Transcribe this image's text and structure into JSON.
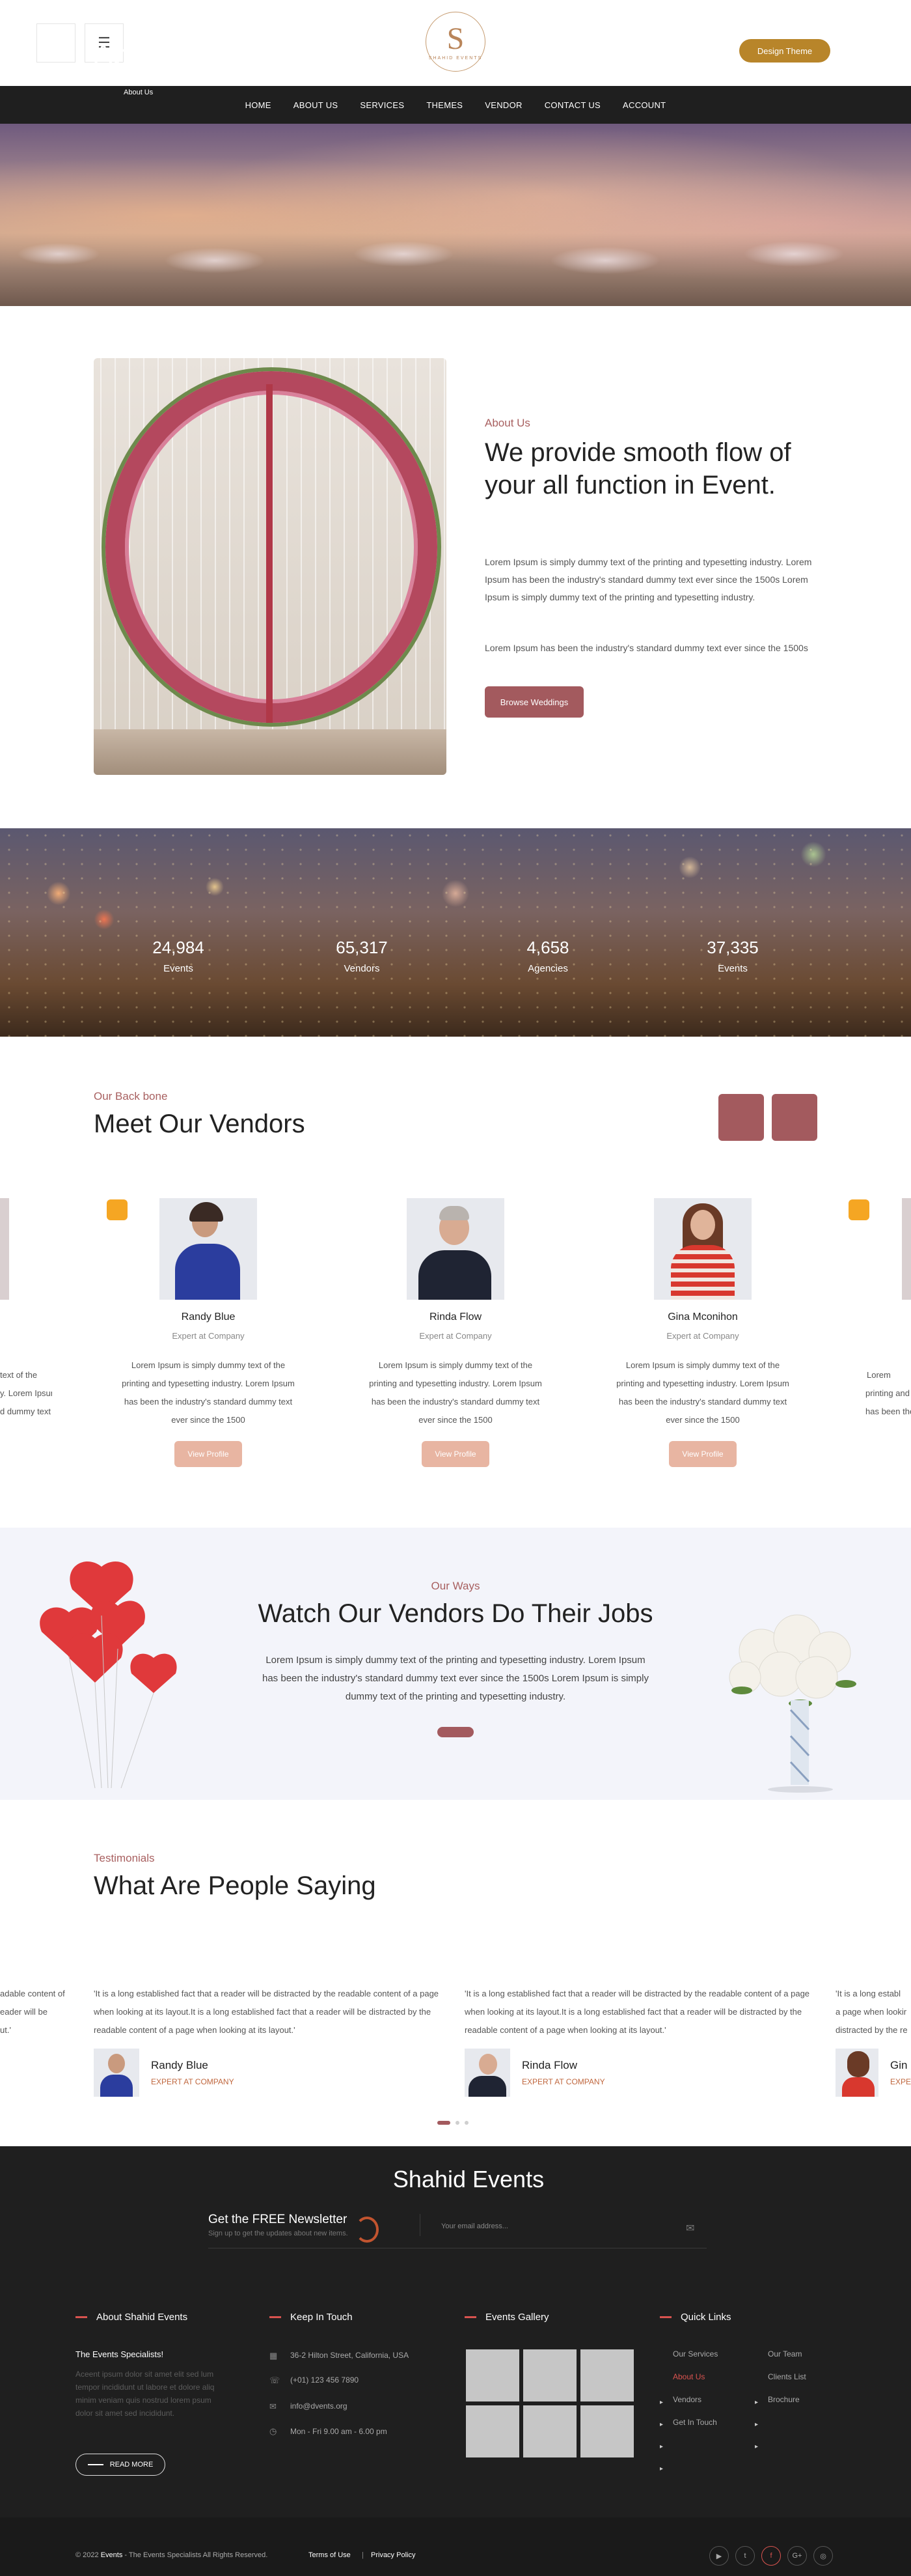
{
  "header": {
    "logo_letter": "S",
    "logo_text": "SHAHID EVENTS",
    "menu_icon": "hamburger-icon",
    "design_button": "Design Theme",
    "brand_color": "#b8852a"
  },
  "nav": [
    "HOME",
    "ABOUT US",
    "SERVICES",
    "THEMES",
    "VENDOR",
    "CONTACT US",
    "ACCOUNT"
  ],
  "hero": {
    "title": "About Us",
    "breadcrumb": "About Us"
  },
  "about": {
    "label": "About Us",
    "heading": "We provide smooth flow of your all function in Event.",
    "p1": "Lorem Ipsum is simply dummy text of the printing and typesetting industry. Lorem Ipsum has been the industry's standard dummy text ever since the 1500s Lorem Ipsum is simply dummy text of the printing and typesetting industry.",
    "p2": "Lorem Ipsum has been the industry's standard dummy text ever since the 1500s",
    "button": "Browse Weddings"
  },
  "counters": [
    {
      "value": "24,984",
      "label": "Events"
    },
    {
      "value": "65,317",
      "label": "Vendors"
    },
    {
      "value": "4,658",
      "label": "Agencies"
    },
    {
      "value": "37,335",
      "label": "Events"
    }
  ],
  "vendors": {
    "label": "Our Back bone",
    "heading": "Meet Our Vendors",
    "cards": [
      {
        "name": "Randy Blue",
        "role": "Expert at Company",
        "desc": "Lorem Ipsum is simply dummy text of the printing and typesetting industry. Lorem Ipsum has been the industry's standard dummy text ever since the 1500",
        "button": "View Profile"
      },
      {
        "name": "Rinda Flow",
        "role": "Expert at Company",
        "desc": "Lorem Ipsum is simply dummy text of the printing and typesetting industry. Lorem Ipsum has been the industry's standard dummy text ever since the 1500",
        "button": "View Profile"
      },
      {
        "name": "Gina Mconihon",
        "role": "Expert at Company",
        "desc": "Lorem Ipsum is simply dummy text of the printing and typesetting industry. Lorem Ipsum has been the industry's standard dummy text ever since the 1500",
        "button": "View Profile"
      }
    ],
    "left_partial": [
      "text of the",
      "y. Lorem Ipsum",
      "d dummy text"
    ],
    "right_partial": [
      "Lorem",
      "printing and",
      "has been the"
    ]
  },
  "ways": {
    "label": "Our Ways",
    "heading": "Watch Our Vendors Do Their Jobs",
    "text": "Lorem Ipsum is simply dummy text of the printing and typesetting industry. Lorem Ipsum has been the industry's standard dummy text ever since the 1500s Lorem Ipsum is simply dummy text of the printing and typesetting industry."
  },
  "testimonials": {
    "label": "Testimonials",
    "heading": "What Are People Saying",
    "items": [
      {
        "quote": "'It is a long established fact that a reader will be distracted by the readable content of a page when looking at its layout.It is a long established fact that a reader will be distracted by the readable content of a page when looking at its layout.'",
        "name": "Randy Blue",
        "role": "EXPERT AT COMPANY"
      },
      {
        "quote": "'It is a long established fact that a reader will be distracted by the readable content of a page when looking at its layout.It is a long established fact that a reader will be distracted by the readable content of a page when looking at its layout.'",
        "name": "Rinda Flow",
        "role": "EXPERT AT COMPANY"
      }
    ],
    "left_partial": [
      "adable content of",
      "eader will be",
      "ut.'"
    ],
    "right_partial": [
      "'It is a long establ",
      "a page when lookir",
      "distracted by the re"
    ],
    "right_person": {
      "name": "Gin",
      "role": "EXPE"
    }
  },
  "footer": {
    "title": "Shahid Events",
    "newsletter_title": "Get the FREE Newsletter",
    "newsletter_sub": "Sign up to get the updates about new items.",
    "email_placeholder": "Your email address...",
    "about_title": "About Shahid Events",
    "about_tag": "The Events Specialists!",
    "about_text": "Aceent ipsum dolor sit amet elit sed lum tempor incididunt ut labore et dolore aliq minim veniam quis nostrud lorem psum dolor sit amet sed incididunt.",
    "read_more": "READ MORE",
    "contact_title": "Keep In Touch",
    "address": "36-2 Hilton Street, California, USA",
    "phone": "(+01) 123 456 7890",
    "email": "info@dvents.org",
    "hours": "Mon - Fri 9.00 am - 6.00 pm",
    "gallery_title": "Events Gallery",
    "links_title": "Quick Links",
    "links_col1": [
      "Our Services",
      "About Us",
      "Vendors",
      "Get In Touch"
    ],
    "links_col2": [
      "Our Team",
      "Clients List",
      "Brochure"
    ],
    "copyright_pre": "© 2022",
    "copyright_brand": "Events",
    "copyright_post": "- The Events Specialists All Rights Reserved.",
    "terms": "Terms of Use",
    "separator": "|",
    "privacy": "Privacy Policy",
    "social": [
      "▶",
      "t",
      "f",
      "G+",
      "◎"
    ]
  },
  "colors": {
    "accent": "#a35a5e",
    "label": "#a86060",
    "footer_bg": "#1f1f1f",
    "highlight": "#d9534f"
  }
}
